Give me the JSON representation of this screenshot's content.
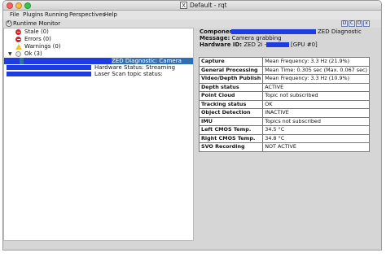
{
  "window": {
    "title": "Default - rqt",
    "x_logo": "X"
  },
  "menu": [
    "File",
    "Plugins",
    "Running",
    "Perspectives",
    "Help"
  ],
  "dock": {
    "title": "Runtime Monitor",
    "icon": "circle-arrow-icon",
    "buttons": [
      "D",
      "C",
      "O",
      "x"
    ]
  },
  "tree": {
    "stale": "Stale (0)",
    "errors": "Errors (0)",
    "warnings": "Warnings (0)",
    "ok": "Ok (3)",
    "items": [
      "ZED Diagnostic: Camera grabbing",
      "Hardware Status: Streaming",
      "Laser Scan topic status:"
    ]
  },
  "details": {
    "component_label": "Component",
    "component_value": "ZED Diagnostic",
    "message_label": "Message:",
    "message_value": "Camera grabbing",
    "hardware_label": "Hardware ID:",
    "hardware_prefix": "ZED 2i - s/n:",
    "hardware_suffix": "[GPU #0]",
    "rows": [
      {
        "label": "Capture",
        "value": "Mean Frequency: 3.3 Hz (21.9%)"
      },
      {
        "label": "General Processing",
        "value": "Mean Time: 0.305 sec (Max. 0.067 sec)"
      },
      {
        "label": "Video/Depth Publish",
        "value": "Mean Frequency: 3.3 Hz (10.9%)"
      },
      {
        "label": "Depth status",
        "value": "ACTIVE"
      },
      {
        "label": "Point Cloud",
        "value": "Topic not subscribed"
      },
      {
        "label": "Tracking status",
        "value": "OK"
      },
      {
        "label": "Object Detection",
        "value": "INACTIVE"
      },
      {
        "label": "IMU",
        "value": "Topics not subscribed"
      },
      {
        "label": "Left CMOS Temp.",
        "value": "34.5 °C"
      },
      {
        "label": "Right CMOS Temp.",
        "value": "34.8 °C"
      },
      {
        "label": "SVO Recording",
        "value": "NOT ACTIVE"
      }
    ]
  },
  "colors": {
    "redaction": "#1f3ce0",
    "selection": "#2f6fb8",
    "error": "#d4222a",
    "warning": "#f2c230"
  }
}
